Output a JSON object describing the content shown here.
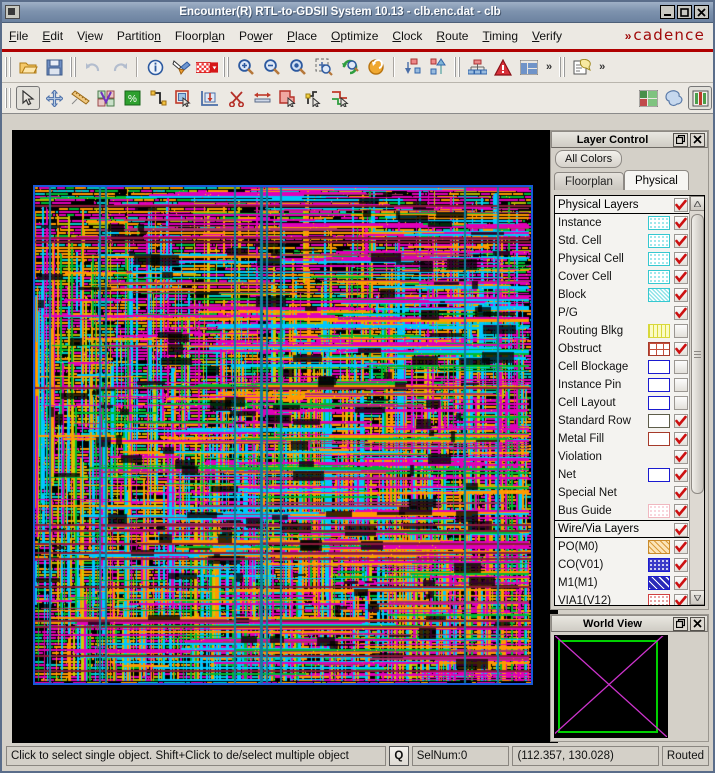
{
  "window": {
    "title": "Encounter(R) RTL-to-GDSII System 10.13 - clb.enc.dat - clb",
    "icon": "window-menu-icon",
    "minimize": "minimize-icon",
    "maximize": "maximize-icon",
    "close": "close-icon"
  },
  "menubar": {
    "items": [
      {
        "label": "File",
        "accel": "F"
      },
      {
        "label": "Edit",
        "accel": "E"
      },
      {
        "label": "View",
        "accel": "i"
      },
      {
        "label": "Partition",
        "accel": "n"
      },
      {
        "label": "Floorplan",
        "accel": "a"
      },
      {
        "label": "Power",
        "accel": "w"
      },
      {
        "label": "Place",
        "accel": "P"
      },
      {
        "label": "Optimize",
        "accel": "O"
      },
      {
        "label": "Clock",
        "accel": "C"
      },
      {
        "label": "Route",
        "accel": "R"
      },
      {
        "label": "Timing",
        "accel": "T"
      },
      {
        "label": "Verify",
        "accel": "V"
      }
    ],
    "brand": "cadence",
    "brand_chevron": "»"
  },
  "toolbar_top": {
    "groups": [
      {
        "items": [
          {
            "name": "open-design-icon",
            "title": "Open Design"
          },
          {
            "name": "save-design-icon",
            "title": "Save Design"
          }
        ]
      },
      {
        "items": [
          {
            "name": "undo-icon",
            "title": "Undo",
            "disabled": true
          },
          {
            "name": "redo-icon",
            "title": "Redo",
            "disabled": true
          }
        ]
      },
      {
        "items": [
          {
            "name": "info-icon",
            "title": "Design Browser"
          },
          {
            "name": "highlight-pen-icon",
            "title": "Highlight"
          },
          {
            "name": "color-palette-dropdown-icon",
            "title": "Color Palette"
          }
        ]
      },
      {
        "items": [
          {
            "name": "zoom-in-icon",
            "title": "Zoom In"
          },
          {
            "name": "zoom-out-icon",
            "title": "Zoom Out"
          },
          {
            "name": "zoom-fit-icon",
            "title": "Fit Design"
          },
          {
            "name": "zoom-selected-icon",
            "title": "Zoom To Selected"
          },
          {
            "name": "redraw-icon",
            "title": "Redraw"
          },
          {
            "name": "undo-view-icon",
            "title": "Previous View"
          }
        ]
      },
      {
        "items": [
          {
            "name": "push-down-icon",
            "title": "Push Down"
          },
          {
            "name": "pop-up-icon",
            "title": "Pop Up"
          }
        ]
      },
      {
        "items": [
          {
            "name": "hierarchy-icon",
            "title": "Design Hierarchy"
          },
          {
            "name": "violation-browser-icon",
            "title": "Violation Browser"
          },
          {
            "name": "windows-icon",
            "title": "Windows"
          }
        ]
      },
      {
        "items": [
          {
            "name": "annotate-icon",
            "title": "Annotation"
          }
        ]
      }
    ],
    "overflow_label": "»"
  },
  "toolbar_bottom": {
    "items": [
      {
        "name": "select-tool-icon",
        "title": "Select",
        "selected": true
      },
      {
        "name": "move-tool-icon",
        "title": "Move/Resize"
      },
      {
        "name": "ruler-tool-icon",
        "title": "Ruler"
      },
      {
        "name": "attribute-editor-icon",
        "title": "Attribute Editor"
      },
      {
        "name": "congestion-icon",
        "title": "Congestion Map"
      },
      {
        "name": "edit-wire-icon",
        "title": "Edit Wire"
      },
      {
        "name": "select-area-icon",
        "title": "Select By Area"
      },
      {
        "name": "snap-floorplan-icon",
        "title": "Snap Floorplan"
      },
      {
        "name": "cut-wire-icon",
        "title": "Cut Wire"
      },
      {
        "name": "stretch-wire-icon",
        "title": "Stretch Wire"
      },
      {
        "name": "add-shape-icon",
        "title": "Add Shape"
      },
      {
        "name": "edit-via-icon",
        "title": "Edit Via"
      },
      {
        "name": "move-wire-icon",
        "title": "Move Wire"
      }
    ],
    "right_items": [
      {
        "name": "layout-view-icon",
        "title": "Layout View"
      },
      {
        "name": "amoeba-view-icon",
        "title": "Amoeba View"
      },
      {
        "name": "layer-control-icon",
        "title": "Layer Control",
        "selected": true
      }
    ]
  },
  "layer_control": {
    "title": "Layer Control",
    "restore_icon": "restore-panel-icon",
    "close_icon": "close-panel-icon",
    "all_colors_label": "All Colors",
    "tabs": [
      {
        "label": "Floorplan",
        "active": false
      },
      {
        "label": "Physical",
        "active": true
      }
    ],
    "rows": [
      {
        "type": "header",
        "label": "Physical Layers",
        "swatch": null,
        "c1": "check",
        "c2": "check"
      },
      {
        "type": "layer",
        "label": "Instance",
        "swatch": {
          "fill": "#ffffff",
          "border": "#35c8d0",
          "pattern": "dots",
          "dot": "#7fe0e6"
        },
        "c1": "check",
        "c2": "check"
      },
      {
        "type": "layer",
        "label": "Std. Cell",
        "swatch": {
          "fill": "#ffffff",
          "border": "#35c8d0",
          "pattern": "dots",
          "dot": "#7fe0e6"
        },
        "c1": "check",
        "c2": "check"
      },
      {
        "type": "layer",
        "label": "Physical Cell",
        "swatch": {
          "fill": "#ffffff",
          "border": "#35c8d0",
          "pattern": "dots",
          "dot": "#7fe0e6"
        },
        "c1": "check",
        "c2": "check"
      },
      {
        "type": "layer",
        "label": "Cover Cell",
        "swatch": {
          "fill": "#ffffff",
          "border": "#35c8d0",
          "pattern": "dots",
          "dot": "#7fe0e6"
        },
        "c1": "check",
        "c2": "check"
      },
      {
        "type": "layer",
        "label": "Block",
        "swatch": {
          "fill": "#8fe3e8",
          "border": "#35c8d0",
          "pattern": "hatch",
          "dot": "#ffffff"
        },
        "c1": "check",
        "c2": "check"
      },
      {
        "type": "layer",
        "label": "P/G",
        "swatch": null,
        "c1": "check",
        "c2": "none"
      },
      {
        "type": "layer",
        "label": "Routing Blkg",
        "swatch": {
          "fill": "#fbfbc4",
          "border": "#d8d83a",
          "pattern": "vlines",
          "dot": "#ffffff"
        },
        "c1": "empty",
        "c2": "check"
      },
      {
        "type": "layer",
        "label": "Obstruct",
        "swatch": {
          "fill": "#ffffff",
          "border": "#a63a2a",
          "pattern": "cross",
          "dot": "#c4503c"
        },
        "c1": "check",
        "c2": "check"
      },
      {
        "type": "layer",
        "label": "Cell Blockage",
        "swatch": {
          "fill": "#ffffff",
          "border": "#1a1ad0",
          "pattern": "none",
          "dot": "#ffffff"
        },
        "c1": "empty",
        "c2": "empty"
      },
      {
        "type": "layer",
        "label": "Instance Pin",
        "swatch": {
          "fill": "#ffffff",
          "border": "#1a1ad0",
          "pattern": "none",
          "dot": "#ffffff"
        },
        "c1": "empty",
        "c2": "none"
      },
      {
        "type": "layer",
        "label": "Cell Layout",
        "swatch": {
          "fill": "#ffffff",
          "border": "#1a1ad0",
          "pattern": "none",
          "dot": "#ffffff"
        },
        "c1": "empty",
        "c2": "none"
      },
      {
        "type": "layer",
        "label": "Standard Row",
        "swatch": {
          "fill": "#ffffff",
          "border": "#5d5d4a",
          "pattern": "none",
          "dot": "#ffffff"
        },
        "c1": "check",
        "c2": "empty"
      },
      {
        "type": "layer",
        "label": "Metal Fill",
        "swatch": {
          "fill": "#ffffff",
          "border": "#a63a2a",
          "pattern": "none",
          "dot": "#ffffff"
        },
        "c1": "check",
        "c2": "check"
      },
      {
        "type": "layer",
        "label": "Violation",
        "swatch": null,
        "c1": "check",
        "c2": "check"
      },
      {
        "type": "layer",
        "label": "Net",
        "swatch": {
          "fill": "#ffffff",
          "border": "#1a1ad0",
          "pattern": "none",
          "dot": "#ffffff"
        },
        "c1": "check",
        "c2": "none"
      },
      {
        "type": "layer",
        "label": "Special Net",
        "swatch": null,
        "c1": "check",
        "c2": "none"
      },
      {
        "type": "layer",
        "label": "Bus Guide",
        "swatch": {
          "fill": "#ffffff",
          "border": "#f0b8c0",
          "pattern": "dots",
          "dot": "#f7c9d2"
        },
        "c1": "check",
        "c2": "check"
      },
      {
        "type": "header",
        "label": "Wire/Via Layers",
        "swatch": null,
        "c1": "check",
        "c2": "check"
      },
      {
        "type": "layer",
        "label": "PO(M0)",
        "swatch": {
          "fill": "#fbe4b8",
          "border": "#c98a2a",
          "pattern": "diag",
          "dot": "#d99b3a"
        },
        "c1": "check",
        "c2": "check"
      },
      {
        "type": "layer",
        "label": "CO(V01)",
        "swatch": {
          "fill": "#3a3ac8",
          "border": "#1a1ad0",
          "pattern": "dots",
          "dot": "#ffffff"
        },
        "c1": "check",
        "c2": "check"
      },
      {
        "type": "layer",
        "label": "M1(M1)",
        "swatch": {
          "fill": "#2a2ab8",
          "border": "#1a1ad0",
          "pattern": "diag2",
          "dot": "#ffffff"
        },
        "c1": "check",
        "c2": "check"
      },
      {
        "type": "layer",
        "label": "VIA1(V12)",
        "swatch": {
          "fill": "#ffffff",
          "border": "#d04040",
          "pattern": "dots",
          "dot": "#e08080"
        },
        "c1": "check",
        "c2": "check"
      }
    ]
  },
  "world_view": {
    "title": "World View",
    "restore_icon": "restore-panel-icon",
    "close_icon": "close-panel-icon",
    "box_color": "#00d000",
    "cross_color": "#cc33cc",
    "background": "#000000"
  },
  "status_bar": {
    "message": "Click to select single object. Shift+Click to de/select multiple object",
    "query_button": "Q",
    "sel_num": "SelNum:0",
    "coordinates": "(112.357, 130.028)",
    "mode": "Routed"
  },
  "canvas": {
    "background": "#000000",
    "die_border_color": "#1858d8",
    "palette": [
      "#ff00cc",
      "#ff9900",
      "#00cccc",
      "#00cc33",
      "#cccc00",
      "#cc0066",
      "#3366ff",
      "#ff3300"
    ]
  }
}
